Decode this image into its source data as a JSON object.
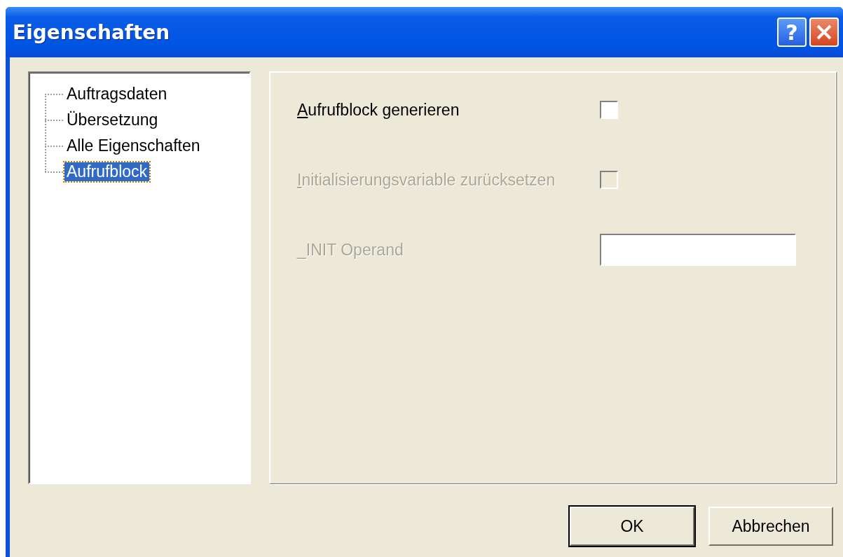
{
  "window": {
    "title": "Eigenschaften",
    "title_buttons": [
      {
        "kind": "help",
        "label": "?"
      },
      {
        "kind": "close"
      }
    ]
  },
  "tree": {
    "items": [
      {
        "label": "Auftragsdaten",
        "selected": false
      },
      {
        "label": "Übersetzung",
        "selected": false
      },
      {
        "label": "Alle Eigenschaften",
        "selected": false
      },
      {
        "label": "Aufrufblock",
        "selected": true
      }
    ]
  },
  "panel": {
    "fields": [
      {
        "kind": "checkbox",
        "label": "Aufrufblock generieren",
        "disabled": false,
        "checked": false,
        "underline_first": true
      },
      {
        "kind": "checkbox",
        "label": "Initialisierungsvariable zurücksetzen",
        "disabled": true,
        "checked": false,
        "underline_first": true
      },
      {
        "kind": "text",
        "label": "_INIT Operand",
        "disabled": true,
        "underline_first": false
      }
    ]
  },
  "buttons": [
    {
      "label": "OK",
      "default": true
    },
    {
      "label": "Abbrechen",
      "default": false
    }
  ]
}
